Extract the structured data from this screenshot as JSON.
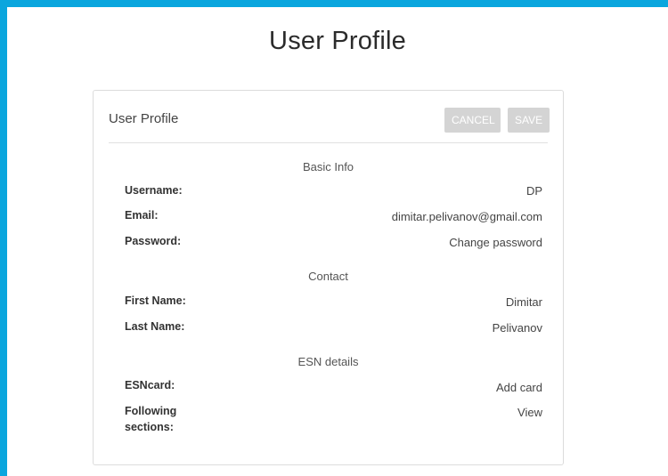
{
  "page": {
    "title": "User Profile"
  },
  "card": {
    "title": "User Profile",
    "buttons": {
      "cancel": "CANCEL",
      "save": "SAVE"
    }
  },
  "sections": {
    "basic": {
      "title": "Basic Info",
      "username": {
        "label": "Username:",
        "value": "DP"
      },
      "email": {
        "label": "Email:",
        "value": "dimitar.pelivanov@gmail.com"
      },
      "password": {
        "label": "Password:",
        "value": "Change password"
      }
    },
    "contact": {
      "title": "Contact",
      "first_name": {
        "label": "First Name:",
        "value": "Dimitar"
      },
      "last_name": {
        "label": "Last Name:",
        "value": "Pelivanov"
      }
    },
    "esn": {
      "title": "ESN details",
      "esncard": {
        "label": "ESNcard:",
        "value": "Add card"
      },
      "following": {
        "label": "Following sections:",
        "value": "View"
      }
    }
  },
  "colors": {
    "frame": "#0aa6de",
    "button_disabled": "#d4d4d4"
  }
}
